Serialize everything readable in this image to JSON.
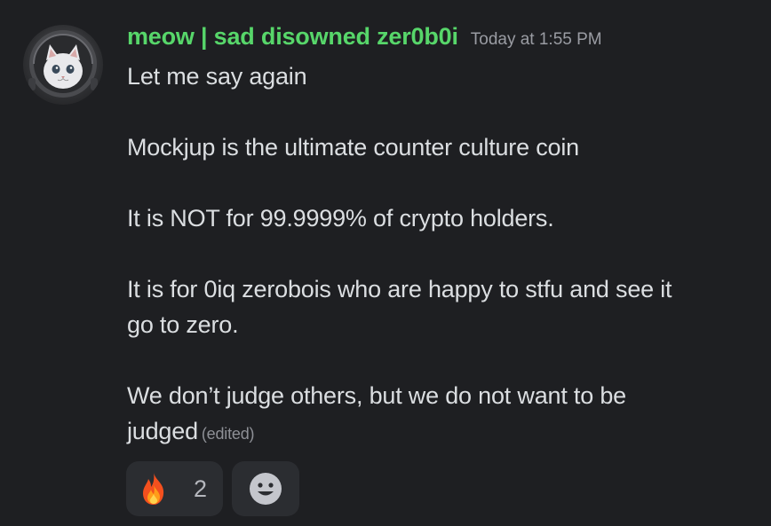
{
  "message": {
    "author": "meow | sad disowned zer0b0i",
    "timestamp": "Today at 1:55 PM",
    "lines": [
      "Let me say again",
      "Mockjup is the ultimate counter culture coin",
      "It is NOT for 99.9999% of crypto holders.",
      "It is for 0iq zerobois who are happy to stfu and see it",
      "go to zero.",
      "We don’t judge others, but we do not want to be",
      "judged"
    ],
    "edited_label": "(edited)"
  },
  "reactions": [
    {
      "emoji": "fire-emoji",
      "count": "2"
    }
  ],
  "add_reaction_icon": "smiley-add-reaction-icon",
  "colors": {
    "background": "#1e1f22",
    "username": "#57d66a",
    "text": "#dbdee1",
    "timestamp": "#9a9ca3",
    "reaction_bg": "#2b2d31"
  }
}
